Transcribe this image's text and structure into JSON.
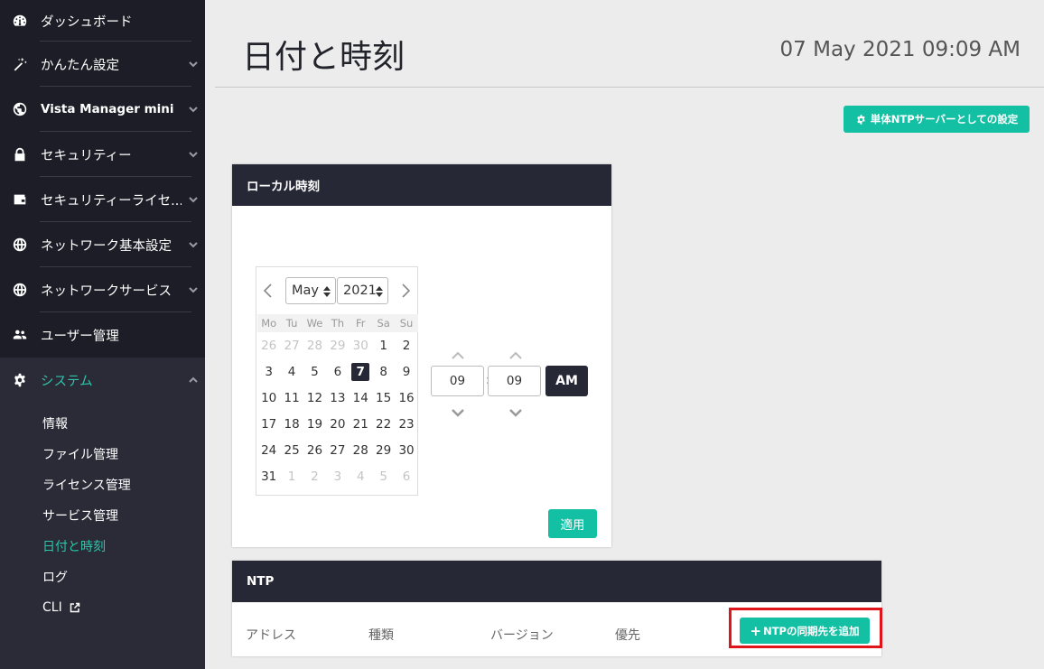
{
  "sidebar": {
    "items": [
      {
        "label": "ダッシュボード",
        "icon": "dashboard-icon"
      },
      {
        "label": "かんたん設定",
        "icon": "magic-wand-icon"
      },
      {
        "label": "Vista Manager mini",
        "icon": "globe-icon"
      },
      {
        "label": "セキュリティー",
        "icon": "lock-icon"
      },
      {
        "label": "セキュリティーライセ...",
        "icon": "wallet-icon"
      },
      {
        "label": "ネットワーク基本設定",
        "icon": "globe-icon"
      },
      {
        "label": "ネットワークサービス",
        "icon": "globe-icon"
      },
      {
        "label": "ユーザー管理",
        "icon": "users-icon"
      },
      {
        "label": "システム",
        "icon": "gear-icon"
      }
    ],
    "system_submenu": [
      "情報",
      "ファイル管理",
      "ライセンス管理",
      "サービス管理",
      "日付と時刻",
      "ログ",
      "CLI"
    ]
  },
  "header": {
    "title": "日付と時刻",
    "current_time": "07 May 2021 09:09 AM",
    "ntp_server_button": "単体NTPサーバーとしての設定"
  },
  "local_time": {
    "title": "ローカル時刻",
    "calendar": {
      "month": "May",
      "year": "2021",
      "weekdays": [
        "Mo",
        "Tu",
        "We",
        "Th",
        "Fr",
        "Sa",
        "Su"
      ],
      "days": [
        "26",
        "27",
        "28",
        "29",
        "30",
        "1",
        "2",
        "3",
        "4",
        "5",
        "6",
        "7",
        "8",
        "9",
        "10",
        "11",
        "12",
        "13",
        "14",
        "15",
        "16",
        "17",
        "18",
        "19",
        "20",
        "21",
        "22",
        "23",
        "24",
        "25",
        "26",
        "27",
        "28",
        "29",
        "30",
        "31",
        "1",
        "2",
        "3",
        "4",
        "5",
        "6"
      ],
      "selected_day": "7"
    },
    "hour": "09",
    "minute": "09",
    "ampm": "AM",
    "apply_label": "適用"
  },
  "ntp": {
    "title": "NTP",
    "columns": [
      "アドレス",
      "種類",
      "バージョン",
      "優先"
    ],
    "add_button": "NTPの同期先を追加"
  }
}
